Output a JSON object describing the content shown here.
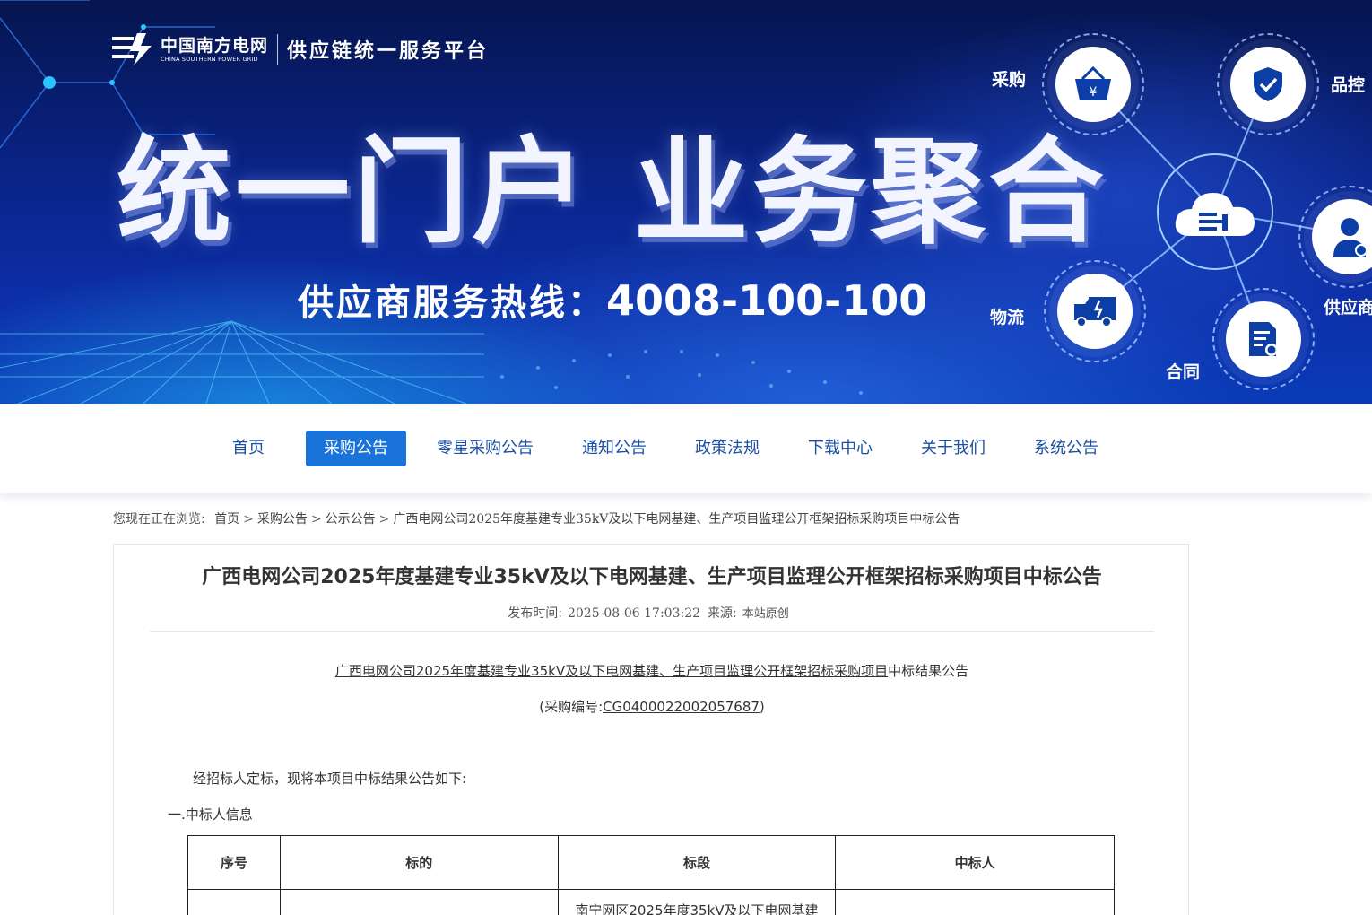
{
  "banner": {
    "logo_cn": "中国南方电网",
    "logo_en": "CHINA SOUTHERN POWER GRID",
    "platform_name": "供应链统一服务平台",
    "slogan": "统一门户 业务聚合",
    "hotline_label": "供应商服务热线：",
    "hotline_number": "4008-100-100",
    "hub": {
      "purchase": "采购",
      "quality": "品控",
      "supplier": "供应商",
      "logistics": "物流",
      "contract": "合同"
    }
  },
  "nav": {
    "items": [
      {
        "label": "首页",
        "active": false
      },
      {
        "label": "采购公告",
        "active": true
      },
      {
        "label": "零星采购公告",
        "active": false
      },
      {
        "label": "通知公告",
        "active": false
      },
      {
        "label": "政策法规",
        "active": false
      },
      {
        "label": "下载中心",
        "active": false
      },
      {
        "label": "关于我们",
        "active": false
      },
      {
        "label": "系统公告",
        "active": false
      }
    ]
  },
  "breadcrumb": {
    "prefix": "您现在正在浏览:",
    "items": [
      "首页",
      "采购公告",
      "公示公告"
    ],
    "separator": ">",
    "current": "广西电网公司2025年度基建专业35kV及以下电网基建、生产项目监理公开框架招标采购项目中标公告"
  },
  "article": {
    "title": "广西电网公司2025年度基建专业35kV及以下电网基建、生产项目监理公开框架招标采购项目中标公告",
    "publish_label": "发布时间:",
    "publish_time": "2025-08-06 17:03:22",
    "source_label": "来源:",
    "source": "本站原创",
    "doc_title_link": "广西电网公司2025年度基建专业35kV及以下电网基建、生产项目监理公开框架招标采购项目",
    "doc_title_suffix": "中标结果公告",
    "code_prefix": "(采购编号:",
    "code": "CG0400022002057687",
    "code_suffix": ")",
    "intro": "经招标人定标，现将本项目中标结果公告如下:",
    "section1": "一.中标人信息",
    "table": {
      "headers": [
        "序号",
        "标的",
        "标段",
        "中标人"
      ],
      "rows": [
        [
          "",
          "",
          "南宁网区2025年度35kV及以下电网基建",
          ""
        ]
      ]
    }
  },
  "colors": {
    "banner_dark": "#06154f",
    "banner_blue": "#0c2fa8",
    "nav_text": "#1a4fa3",
    "nav_active_bg": "#1a73d9",
    "icon_blue": "#0b3ea6"
  }
}
